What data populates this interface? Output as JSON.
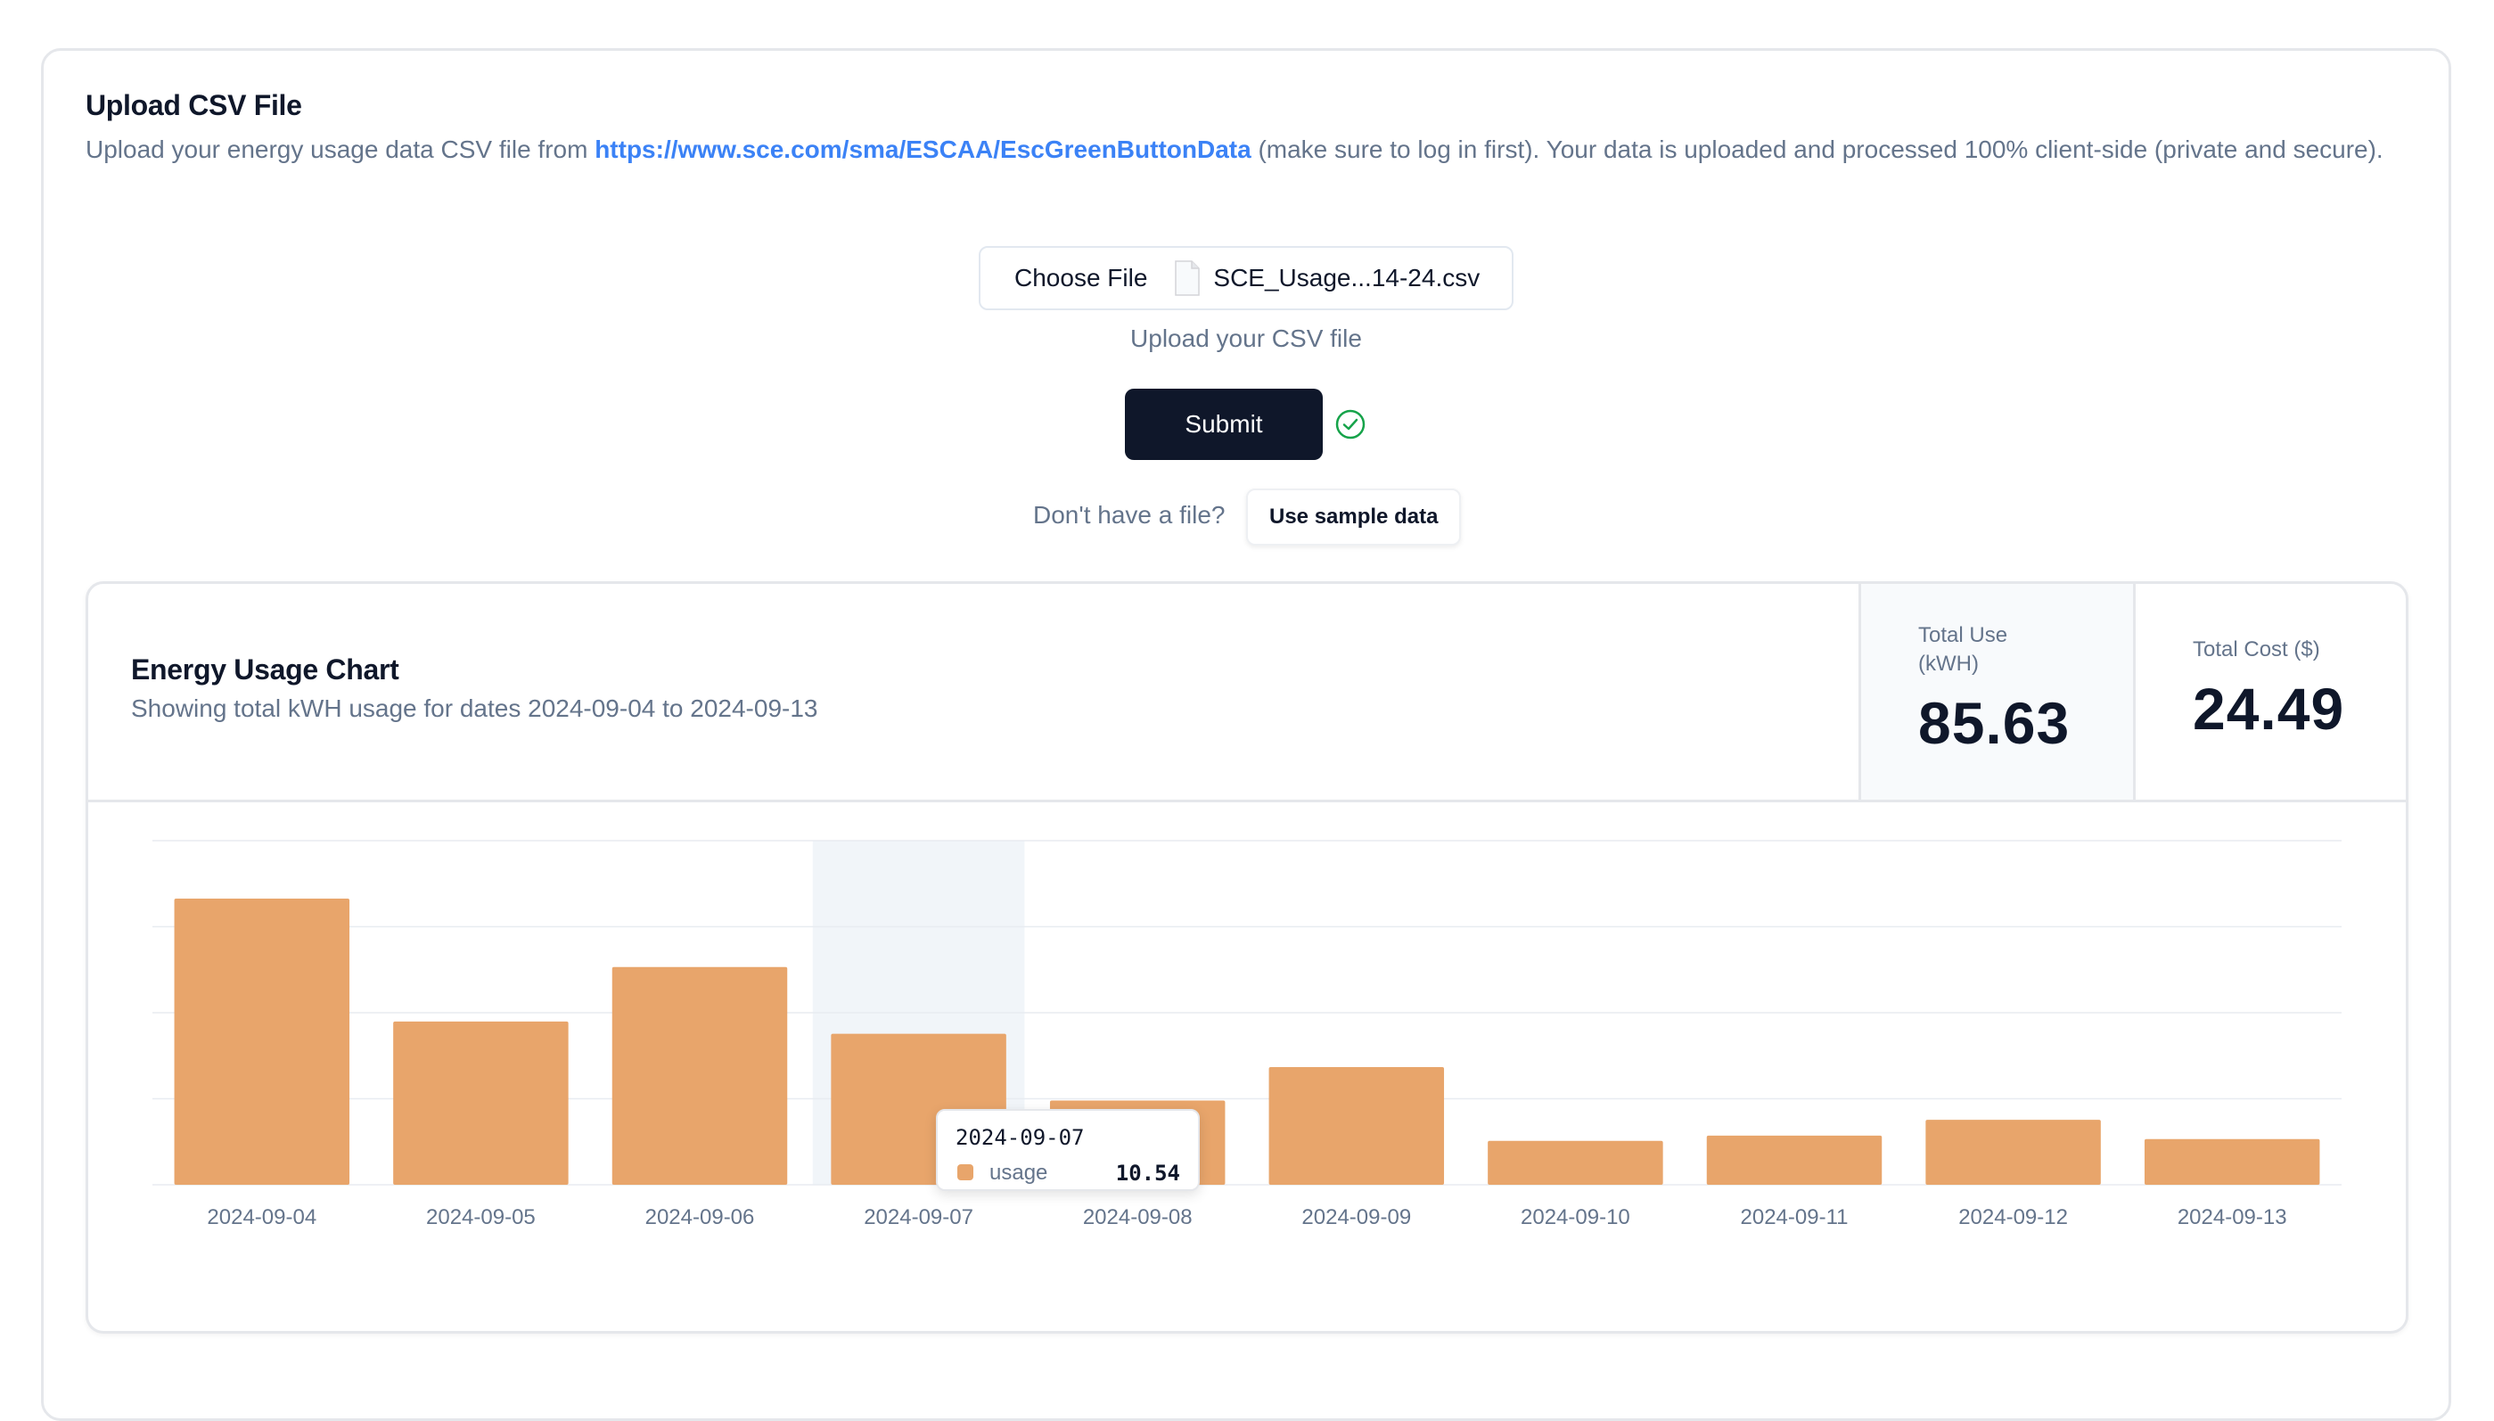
{
  "upload": {
    "title": "Upload CSV File",
    "desc_prefix": "Upload your energy usage data CSV file from ",
    "desc_link": "https://www.sce.com/sma/ESCAA/EscGreenButtonData",
    "desc_suffix": " (make sure to log in first). Your data is uploaded and processed 100% client-side (private and secure).",
    "choose_file_label": "Choose File",
    "file_name": "SCE_Usage...14-24.csv",
    "hint": "Upload your CSV file",
    "submit_label": "Submit",
    "no_file_text": "Don't have a file?",
    "sample_label": "Use sample data"
  },
  "chart_card": {
    "title": "Energy Usage Chart",
    "subtitle": "Showing total kWH usage for dates 2024-09-04 to 2024-09-13",
    "stats": [
      {
        "label": "Total Use (kWH)",
        "value": "85.63",
        "active": true
      },
      {
        "label": "Total Cost ($)",
        "value": "24.49",
        "active": false
      }
    ]
  },
  "tooltip": {
    "date": "2024-09-07",
    "key": "usage",
    "value": "10.54"
  },
  "colors": {
    "bar": "#e8a56b",
    "highlight": "#f1f5f9",
    "primary": "#0f172a",
    "link": "#3b82f6",
    "success": "#16a34a"
  },
  "icons": {
    "file": "file-icon",
    "check": "check-circle-icon"
  },
  "chart_data": {
    "type": "bar",
    "categories": [
      "2024-09-04",
      "2024-09-05",
      "2024-09-06",
      "2024-09-07",
      "2024-09-08",
      "2024-09-09",
      "2024-09-10",
      "2024-09-11",
      "2024-09-12",
      "2024-09-13"
    ],
    "series": [
      {
        "name": "usage",
        "values": [
          16.3,
          9.3,
          12.4,
          8.6,
          4.8,
          6.7,
          2.5,
          2.8,
          3.7,
          2.6
        ]
      }
    ],
    "ylim": [
      0,
      19.6
    ],
    "grid": true,
    "highlighted_category": "2024-09-07"
  }
}
